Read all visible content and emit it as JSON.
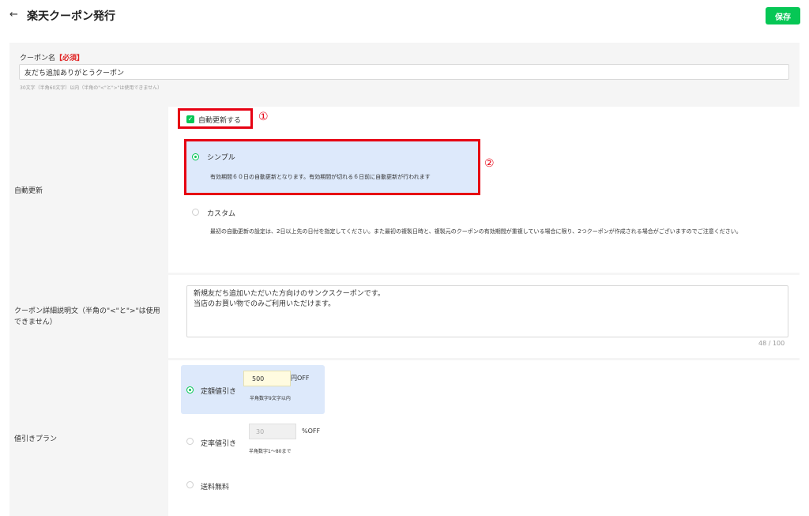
{
  "header": {
    "back_icon": "←",
    "title": "楽天クーポン発行",
    "save_label": "保存"
  },
  "colors": {
    "accent": "#06c755",
    "highlight": "#e60012",
    "selected_bg": "#dde9fb"
  },
  "coupon_name": {
    "label": "クーポン名",
    "required": "【必須】",
    "value": "友だち追加ありがとうクーポン",
    "hint": "30文字（半角60文字）以内（半角の\"<\"と\">\"は使用できません）"
  },
  "auto_update": {
    "row_label": "自動更新",
    "checkbox_label": "自動更新する",
    "checkbox_checked": true,
    "marker_1": "①",
    "marker_2": "②",
    "options": [
      {
        "label": "シンプル",
        "selected": true,
        "desc": "有効期間６０日の自動更新となります。有効期間が切れる６日前に自動更新が行われます"
      },
      {
        "label": "カスタム",
        "selected": false,
        "desc": "最初の自動更新の設定は、2日以上先の日付を指定してください。また最初の複製日時と、複製元のクーポンの有効期間が重複している場合に限り、2つクーポンが作成される場合がございますのでご注意ください。"
      }
    ]
  },
  "description": {
    "row_label": "クーポン詳細説明文（半角の\"<\"と\">\"は使用できません）",
    "value": "新規友だち追加いただいた方向けのサンクスクーポンです。\n当店のお買い物でのみご利用いただけます。",
    "count": "48 / 100"
  },
  "discount_plan": {
    "row_label": "値引きプラン",
    "fixed": {
      "label": "定額値引き",
      "value": "500",
      "unit": "円OFF",
      "hint": "半角数字9文字以内",
      "selected": true
    },
    "rate": {
      "label": "定率値引き",
      "value": "30",
      "unit": "%OFF",
      "hint": "半角数字1〜80まで",
      "selected": false
    },
    "free_shipping": {
      "label": "送料無料",
      "selected": false
    }
  }
}
